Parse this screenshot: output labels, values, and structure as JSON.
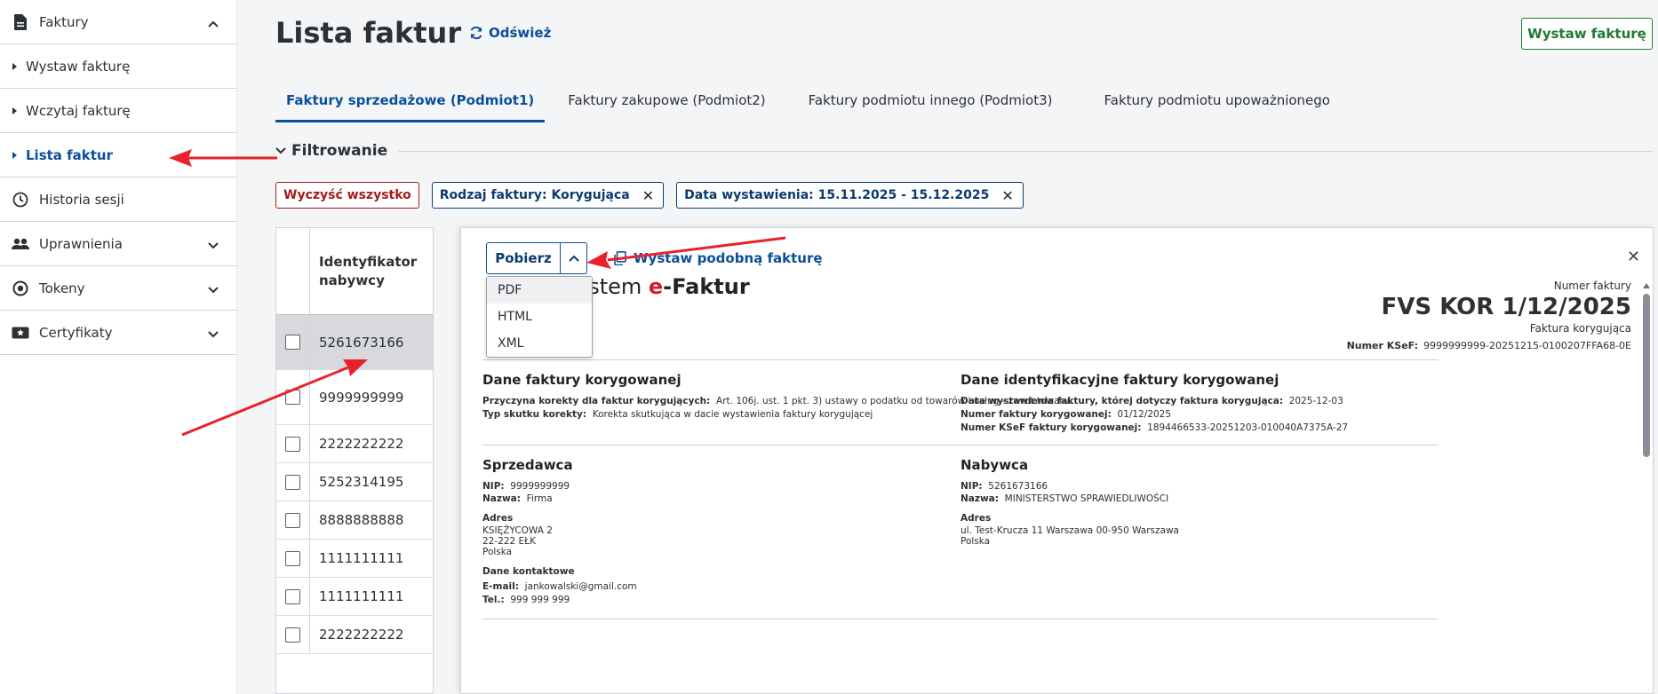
{
  "sidebar": {
    "section_invoices": "Faktury",
    "items": [
      {
        "label": "Wystaw fakturę"
      },
      {
        "label": "Wczytaj fakturę"
      },
      {
        "label": "Lista faktur"
      }
    ],
    "history": "Historia sesji",
    "permissions": "Uprawnienia",
    "tokens": "Tokeny",
    "certificates": "Certyfikaty"
  },
  "header": {
    "title": "Lista faktur",
    "refresh": "Odśwież",
    "issue_button": "Wystaw fakturę"
  },
  "tabs": [
    {
      "label": "Faktury sprzedażowe (Podmiot1)"
    },
    {
      "label": "Faktury zakupowe (Podmiot2)"
    },
    {
      "label": "Faktury podmiotu innego (Podmiot3)"
    },
    {
      "label": "Faktury podmiotu upoważnionego"
    }
  ],
  "filters": {
    "heading": "Filtrowanie",
    "clear_all": "Wyczyść wszystko",
    "chips": [
      {
        "label": "Rodzaj faktury: Korygująca"
      },
      {
        "label": "Data wystawienia: 15.11.2025 - 15.12.2025"
      }
    ]
  },
  "table": {
    "header": "Identyfikator nabywcy",
    "rows": [
      "5261673166",
      "9999999999",
      "2222222222",
      "5252314195",
      "8888888888",
      "1111111111",
      "1111111111",
      "2222222222"
    ]
  },
  "preview": {
    "download": "Pobierz",
    "similar": "Wystaw podobną fakturę",
    "download_options": [
      "PDF",
      "HTML",
      "XML"
    ],
    "brand_prefix": "ystem ",
    "brand_e": "e",
    "brand_suffix": "-Faktur",
    "invoice_number_label": "Numer faktury",
    "invoice_number": "FVS KOR 1/12/2025",
    "invoice_type": "Faktura korygująca",
    "ksef_label": "Numer KSeF:",
    "ksef_value": "9999999999-20251215-0100207FFA68-0E",
    "corrected": {
      "title": "Dane faktury korygowanej",
      "reason_label": "Przyczyna korekty dla faktur korygujących:",
      "reason_value": "Art. 106j. ust. 1 pkt. 3) ustawy o podatku od towarów i usług - zwrot towaru.",
      "effect_label": "Typ skutku korekty:",
      "effect_value": "Korekta skutkująca w dacie wystawienia faktury korygującej"
    },
    "corrected_id": {
      "title": "Dane identyfikacyjne faktury korygowanej",
      "date_label": "Data wystawienia faktury, której dotyczy faktura korygująca:",
      "date_value": "2025-12-03",
      "number_label": "Numer faktury korygowanej:",
      "number_value": "01/12/2025",
      "ksef_label": "Numer KSeF faktury korygowanej:",
      "ksef_value": "1894466533-20251203-010040A7375A-27"
    },
    "seller": {
      "title": "Sprzedawca",
      "nip_label": "NIP:",
      "nip": "9999999999",
      "name_label": "Nazwa:",
      "name": "Firma",
      "address_label": "Adres",
      "address_line1": "KSIĘŻYCOWA 2",
      "address_line2": "22-222 EŁK",
      "address_line3": "Polska",
      "contact_label": "Dane kontaktowe",
      "email_label": "E-mail:",
      "email": "jankowalski@gmail.com",
      "phone_label": "Tel.:",
      "phone": "999 999 999"
    },
    "buyer": {
      "title": "Nabywca",
      "nip_label": "NIP:",
      "nip": "5261673166",
      "name_label": "Nazwa:",
      "name": "MINISTERSTWO SPRAWIEDLIWOŚCI",
      "address_label": "Adres",
      "address_line1": "ul. Test-Krucza 11 Warszawa 00-950 Warszawa",
      "address_line2": "Polska"
    }
  },
  "colors": {
    "primary": "#0b4f9a",
    "success": "#1d7a2e",
    "danger": "#a31b1b",
    "brand_red": "#cf1d2a",
    "arrow": "#e8212a"
  }
}
